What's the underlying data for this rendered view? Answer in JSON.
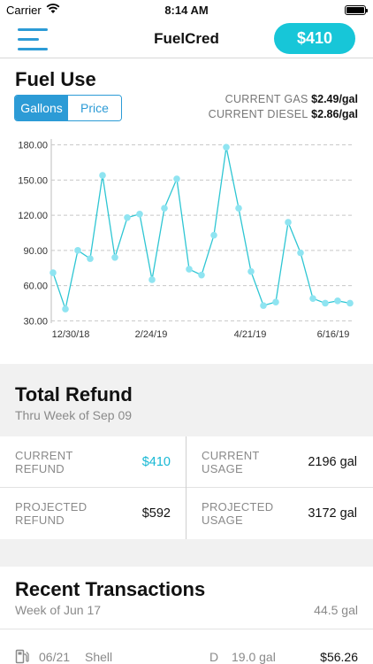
{
  "status_bar": {
    "carrier": "Carrier",
    "time": "8:14 AM"
  },
  "nav": {
    "title": "FuelCred",
    "balance": "$410"
  },
  "fuel_use": {
    "title": "Fuel Use",
    "toggle": {
      "options": [
        "Gallons",
        "Price"
      ],
      "selected": "Gallons"
    },
    "gas_label": "CURRENT GAS",
    "gas_price": "$2.49/gal",
    "diesel_label": "CURRENT DIESEL",
    "diesel_price": "$2.86/gal"
  },
  "chart_data": {
    "type": "line",
    "x_tick_labels": [
      "12/30/18",
      "2/24/19",
      "4/21/19",
      "6/16/19"
    ],
    "y_ticks": [
      30,
      60,
      90,
      120,
      150,
      180
    ],
    "y_tick_labels": [
      "30.00",
      "60.00",
      "90.00",
      "120.00",
      "150.00",
      "180.00"
    ],
    "ylim": [
      28,
      185
    ],
    "grid": true,
    "line_color": "#2ec6d3",
    "point_color": "#8fe4f1",
    "values": [
      71,
      40,
      90,
      83,
      154,
      84,
      118,
      121,
      65,
      126,
      151,
      74,
      69,
      103,
      178,
      126,
      72,
      43,
      46,
      114,
      88,
      49,
      45,
      47,
      45
    ]
  },
  "total_refund": {
    "title": "Total Refund",
    "subtitle": "Thru Week of Sep 09",
    "stats": [
      {
        "label_line1": "CURRENT",
        "label_line2": "REFUND",
        "value": "$410"
      },
      {
        "label_line1": "CURRENT",
        "label_line2": "USAGE",
        "value": "2196 gal"
      },
      {
        "label_line1": "PROJECTED",
        "label_line2": "REFUND",
        "value": "$592"
      },
      {
        "label_line1": "PROJECTED",
        "label_line2": "USAGE",
        "value": "3172 gal"
      }
    ],
    "accent_color": "#17b8d4"
  },
  "recent_transactions": {
    "title": "Recent Transactions",
    "subtitle": "Week of Jun 17",
    "total": "44.5 gal",
    "rows": [
      {
        "icon": "fuel-pump-icon",
        "date": "06/21",
        "vendor": "Shell",
        "fuel_type": "D",
        "quantity": "19.0 gal",
        "amount": "$56.26"
      }
    ]
  },
  "colors": {
    "primary": "#2c9bd6",
    "accent": "#17c6d8"
  }
}
